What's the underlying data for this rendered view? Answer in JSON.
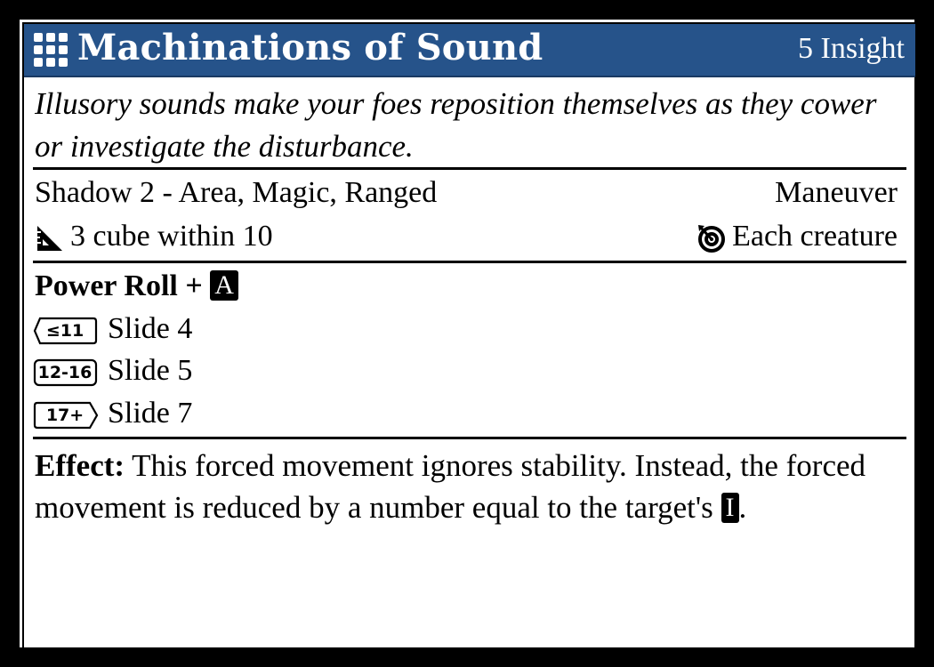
{
  "header": {
    "icon": "grid-icon",
    "title": "Machinations of Sound",
    "cost": "5 Insight",
    "background_color": "#26538a"
  },
  "flavor": "Illusory sounds make your foes reposition themselves as they cower or investigate the disturbance.",
  "keywords": "Shadow 2 - Area, Magic, Ranged",
  "action_type": "Maneuver",
  "distance": {
    "icon": "ruler-triangle-icon",
    "text": "3 cube within 10"
  },
  "target": {
    "icon": "target-icon",
    "text": "Each creature"
  },
  "power_roll": {
    "label": "Power Roll +",
    "characteristic": "A",
    "tiers": [
      {
        "badge": "≤11",
        "result": "Slide 4"
      },
      {
        "badge": "12-16",
        "result": "Slide 5"
      },
      {
        "badge": "17+",
        "result": "Slide 7"
      }
    ]
  },
  "effect": {
    "label": "Effect:",
    "text": "This forced movement ignores stability. Instead, the forced movement is reduced by a number equal to the target's",
    "characteristic": "I",
    "end": "."
  }
}
